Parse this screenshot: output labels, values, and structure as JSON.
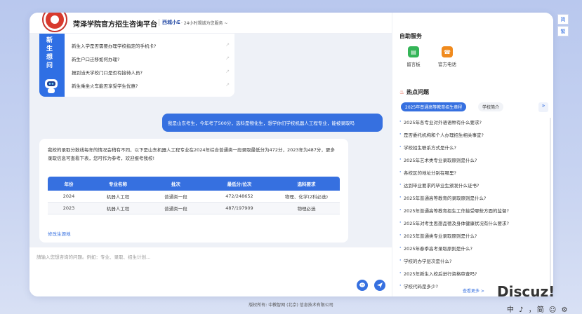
{
  "header": {
    "title": "菏泽学院官方招生咨询平台",
    "brand": "西城小E",
    "tagline": "· 24小时竭诚为您服务 ~"
  },
  "faq": {
    "side_chars": [
      "新",
      "生",
      "想",
      "问"
    ],
    "items": [
      "新生入学是否需要办理学校指定的手机卡?",
      "新生户口迁移如何办理?",
      "报到当天学校门口是否有接待人员?",
      "新生乘坐火车能否享受学生优惠?"
    ]
  },
  "chat": {
    "user_message": "我是山东考生，今年考了500分，选科是物化生，想学你们学校机器人工程专业，能被录取吗",
    "bot_message": "我校的录取分数线每年的情况会稍有不同，以下是山东机器人工程专业在2024年综合普通类一段录取最低分为472分，2023年为487分，更多录取信息可查看下表，您可作为参考，欢迎报考我校!",
    "table": {
      "headers": [
        "年份",
        "专业名称",
        "批次",
        "最低分/位次",
        "选科要求"
      ],
      "rows": [
        [
          "2024",
          "机器人工程",
          "普通类一段",
          "472/248652",
          "物理、化学(2科必选)"
        ],
        [
          "2023",
          "机器人工程",
          "普通类一段",
          "487/197909",
          "物理必选"
        ]
      ]
    },
    "modify_link": "修改生源地"
  },
  "input": {
    "placeholder": "請输入您想咨询的问题。例如：专业、录取、招生计划..."
  },
  "service": {
    "title": "自助服务",
    "items": [
      {
        "label": "留言板",
        "icon": "message-board-icon",
        "color": "#35b558"
      },
      {
        "label": "官方电话",
        "icon": "phone-icon",
        "color": "#f08a1d"
      }
    ]
  },
  "hot": {
    "title": "热点问题",
    "tabs": [
      "2025年普通高等教育招生章程",
      "学校简介"
    ],
    "more_tab": "»",
    "items": [
      "2025年各专业对外语语种有什么要求?",
      "是否委托机构和个人办理招生相关事宜?",
      "学校招生联系方式是什么?",
      "2025年艺术类专业录取原则是什么?",
      "各校区的地址分别在哪里?",
      "达到毕业要求的毕业生颁发什么证书?",
      "2025年普通高等教育的录取原则是什么?",
      "2025年普通高等教育招生工作接受哪些方面的监督?",
      "2025年对考生思想品德及身体健康状况有什么要求?",
      "2025年普通类专业录取原则是什么?",
      "2025年春季高考录取原则是什么?",
      "学校的办学层次是什么?",
      "2025年新生入校后进行资格审查吗?",
      "学校代码是多少?"
    ],
    "see_more": "查看更多 >"
  },
  "lang_switch": [
    "简",
    "繁"
  ],
  "footer": "版权所有: 中教智网 (北京) 信息技术有限公司",
  "watermark": {
    "title": "Discuz!",
    "bar": "中 ♪ ，简 ☺ ⚙"
  },
  "colors": {
    "accent": "#3670e0",
    "background": "#c7d3f1"
  }
}
